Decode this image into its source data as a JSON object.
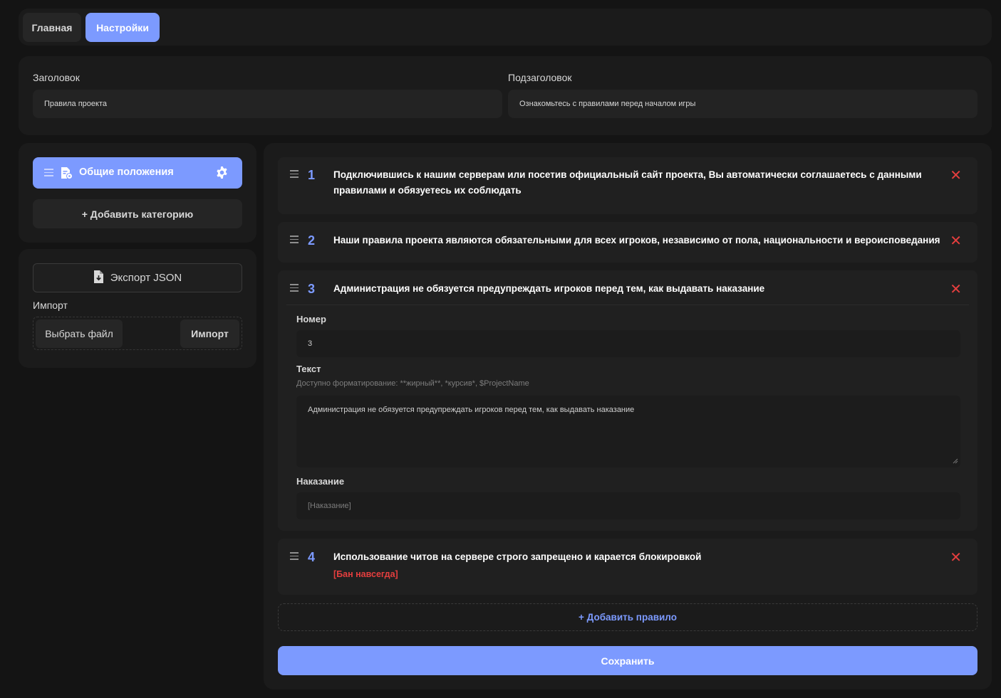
{
  "tabs": [
    {
      "label": "Главная",
      "active": false
    },
    {
      "label": "Настройки",
      "active": true
    }
  ],
  "header": {
    "title_label": "Заголовок",
    "title_value": "Правила проекта",
    "subtitle_label": "Подзаголовок",
    "subtitle_value": "Ознакомьтесь с правилами перед началом игры"
  },
  "sidebar": {
    "categories": [
      {
        "label": "Общие положения",
        "icon": "document-settings-icon",
        "active": true
      }
    ],
    "add_category_label": "+ Добавить категорию",
    "export_label": "Экспорт JSON",
    "import_label": "Импорт",
    "choose_file_label": "Выбрать файл",
    "import_button_label": "Импорт"
  },
  "rules": [
    {
      "number": "1",
      "text": "Подключившись к нашим серверам или посетив официальный сайт проекта, Вы автоматически соглашаетесь с данными правилами и обязуетесь их соблюдать",
      "punishment": ""
    },
    {
      "number": "2",
      "text": "Наши правила проекта являются обязательными для всех игроков, независимо от пола, национальности и вероисповедания",
      "punishment": ""
    },
    {
      "number": "3",
      "text": "Администрация не обязуется предупреждать игроков перед тем, как выдавать наказание",
      "punishment": "",
      "expanded": true
    },
    {
      "number": "4",
      "text": "Использование читов на сервере строго запрещено и карается блокировкой",
      "punishment": "[Бан навсегда]"
    }
  ],
  "editor": {
    "number_label": "Номер",
    "number_value": "3",
    "text_label": "Текст",
    "text_hint": "Доступно форматирование: **жирный**, *курсив*, $ProjectName",
    "text_value": "Администрация не обязуется предупреждать игроков перед тем, как выдавать наказание",
    "punishment_label": "Наказание",
    "punishment_placeholder": "[Наказание]"
  },
  "add_rule_label": "+ Добавить правило",
  "save_label": "Сохранить",
  "colors": {
    "accent": "#7c9aff",
    "danger": "#e53e3e",
    "background": "#141414",
    "panel": "#1b1b1b"
  }
}
